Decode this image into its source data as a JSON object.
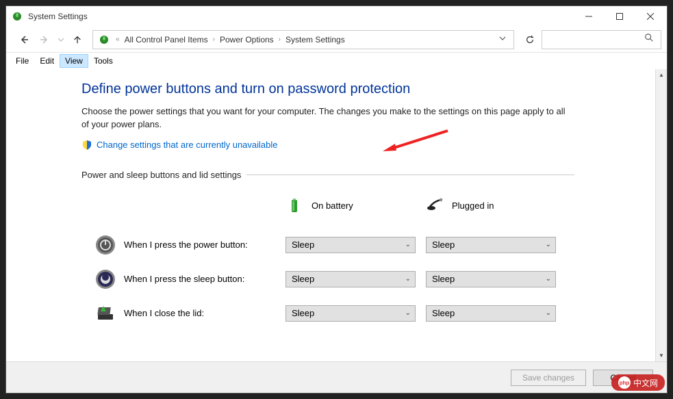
{
  "window": {
    "title": "System Settings"
  },
  "breadcrumb": {
    "items": [
      "All Control Panel Items",
      "Power Options",
      "System Settings"
    ]
  },
  "menu": {
    "file": "File",
    "edit": "Edit",
    "view": "View",
    "tools": "Tools"
  },
  "page": {
    "heading": "Define power buttons and turn on password protection",
    "description": "Choose the power settings that you want for your computer. The changes you make to the settings on this page apply to all of your power plans.",
    "change_link": "Change settings that are currently unavailable",
    "section_label": "Power and sleep buttons and lid settings"
  },
  "columns": {
    "battery": "On battery",
    "plugged": "Plugged in"
  },
  "rows": [
    {
      "label": "When I press the power button:",
      "battery": "Sleep",
      "plugged": "Sleep"
    },
    {
      "label": "When I press the sleep button:",
      "battery": "Sleep",
      "plugged": "Sleep"
    },
    {
      "label": "When I close the lid:",
      "battery": "Sleep",
      "plugged": "Sleep"
    }
  ],
  "footer": {
    "save": "Save changes",
    "cancel": "Cancel"
  },
  "watermark": "中文网"
}
